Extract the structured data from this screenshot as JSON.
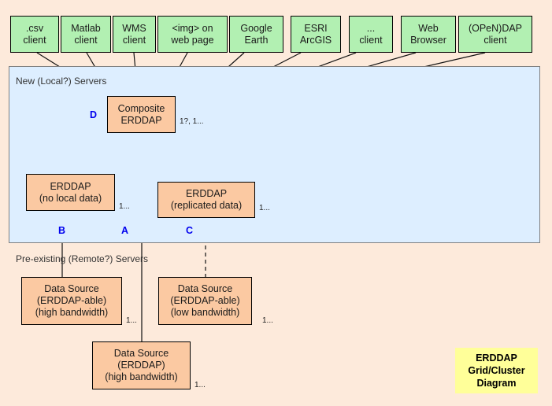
{
  "diagram": {
    "background_color": "#fdeadb",
    "legend": {
      "line1": "ERDDAP",
      "line2": "Grid/Cluster",
      "line3": "Diagram",
      "color": "#ffff99"
    },
    "panels": [
      {
        "label": "New (Local?) Servers",
        "color": "#ddeeff"
      },
      {
        "label": "Pre-existing (Remote?) Servers",
        "color": "#fdeadb"
      }
    ],
    "clients": [
      {
        "line1": ".csv",
        "line2": "client"
      },
      {
        "line1": "Matlab",
        "line2": "client"
      },
      {
        "line1": "WMS",
        "line2": "client"
      },
      {
        "line1": "<img> on",
        "line2": "web page"
      },
      {
        "line1": "Google",
        "line2": "Earth"
      },
      {
        "line1": "ESRI",
        "line2": "ArcGIS"
      },
      {
        "line1": "...",
        "line2": "client"
      },
      {
        "line1": "Web",
        "line2": "Browser"
      },
      {
        "line1": "(OPeN)DAP",
        "line2": "client"
      }
    ],
    "composite": {
      "line1": "Composite",
      "line2": "ERDDAP"
    },
    "servers": [
      {
        "line1": "ERDDAP",
        "line2": "(no local data)",
        "line3": ""
      },
      {
        "line1": "ERDDAP",
        "line2": "(replicated data)",
        "line3": ""
      }
    ],
    "sources": [
      {
        "line1": "Data Source",
        "line2": "(ERDDAP-able)",
        "line3": "(high bandwidth)"
      },
      {
        "line1": "Data Source",
        "line2": "(ERDDAP-able)",
        "line3": "(low bandwidth)"
      },
      {
        "line1": "Data Source",
        "line2": "(ERDDAP)",
        "line3": "(high bandwidth)"
      }
    ],
    "multiplicities": {
      "composite": "1?, 1...",
      "no_local_data": "1...",
      "replicated_data": "1...",
      "source_high_able": "1...",
      "source_low_able": "1...",
      "source_erddap": "1..."
    },
    "letters": {
      "d": "D",
      "b": "B",
      "a": "A",
      "c": "C",
      "color": "#0000ee"
    }
  }
}
